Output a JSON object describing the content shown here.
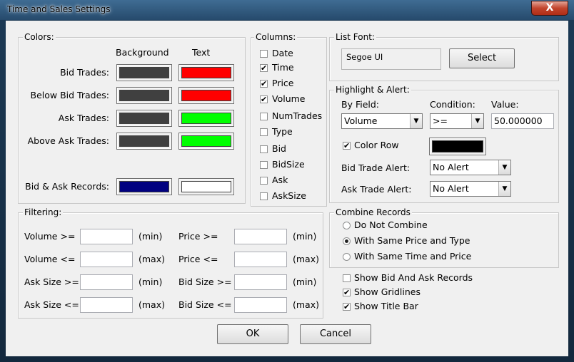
{
  "window": {
    "title": "Time and Sales Settings",
    "close_glyph": "X"
  },
  "colors_group": {
    "label": "Colors:",
    "background_header": "Background",
    "text_header": "Text",
    "rows": [
      {
        "label": "Bid Trades:",
        "background": "#404040",
        "text": "#ff0000"
      },
      {
        "label": "Below Bid Trades:",
        "background": "#404040",
        "text": "#ff0000"
      },
      {
        "label": "Ask Trades:",
        "background": "#404040",
        "text": "#00ff00"
      },
      {
        "label": "Above Ask Trades:",
        "background": "#404040",
        "text": "#00ff00"
      },
      {
        "label": "Bid & Ask Records:",
        "background": "#000080",
        "text": "#ffffff"
      }
    ]
  },
  "columns_group": {
    "label": "Columns:",
    "items": [
      {
        "label": "Date",
        "checked": false
      },
      {
        "label": "Time",
        "checked": true
      },
      {
        "label": "Price",
        "checked": true
      },
      {
        "label": "Volume",
        "checked": true
      },
      {
        "label": "NumTrades",
        "checked": false
      },
      {
        "label": "Type",
        "checked": false
      },
      {
        "label": "Bid",
        "checked": false
      },
      {
        "label": "BidSize",
        "checked": false
      },
      {
        "label": "Ask",
        "checked": false
      },
      {
        "label": "AskSize",
        "checked": false
      }
    ]
  },
  "list_font": {
    "label": "List Font:",
    "font_name": "Segoe UI",
    "select_label": "Select"
  },
  "highlight": {
    "label": "Highlight & Alert:",
    "by_field_label": "By Field:",
    "condition_label": "Condition:",
    "value_label": "Value:",
    "by_field_value": "Volume",
    "condition_value": ">=",
    "value": "50.000000",
    "color_row_label": "Color Row",
    "color_row_checked": true,
    "color_row_color": "#000000",
    "bid_alert_label": "Bid Trade Alert:",
    "bid_alert_value": "No Alert",
    "ask_alert_label": "Ask Trade Alert:",
    "ask_alert_value": "No Alert"
  },
  "filtering": {
    "label": "Filtering:",
    "fields": [
      {
        "label": "Volume >=",
        "unit": "(min)",
        "value": ""
      },
      {
        "label": "Volume <=",
        "unit": "(max)",
        "value": ""
      },
      {
        "label": "Ask Size >=",
        "unit": "(min)",
        "value": ""
      },
      {
        "label": "Ask Size <=",
        "unit": "(max)",
        "value": ""
      },
      {
        "label": "Price >=",
        "unit": "(min)",
        "value": ""
      },
      {
        "label": "Price <=",
        "unit": "(max)",
        "value": ""
      },
      {
        "label": "Bid Size >=",
        "unit": "(min)",
        "value": ""
      },
      {
        "label": "Bid Size <=",
        "unit": "(max)",
        "value": ""
      }
    ]
  },
  "combine": {
    "label": "Combine Records",
    "options": [
      {
        "label": "Do Not Combine",
        "selected": false
      },
      {
        "label": "With Same Price and Type",
        "selected": true
      },
      {
        "label": "With Same Time and Price",
        "selected": false
      }
    ]
  },
  "options": [
    {
      "label": "Show Bid And Ask Records",
      "checked": false
    },
    {
      "label": "Show Gridlines",
      "checked": true
    },
    {
      "label": "Show Title Bar",
      "checked": true
    }
  ],
  "buttons": {
    "ok": "OK",
    "cancel": "Cancel"
  },
  "check_glyph": "✔",
  "arrow_glyph": "▼"
}
